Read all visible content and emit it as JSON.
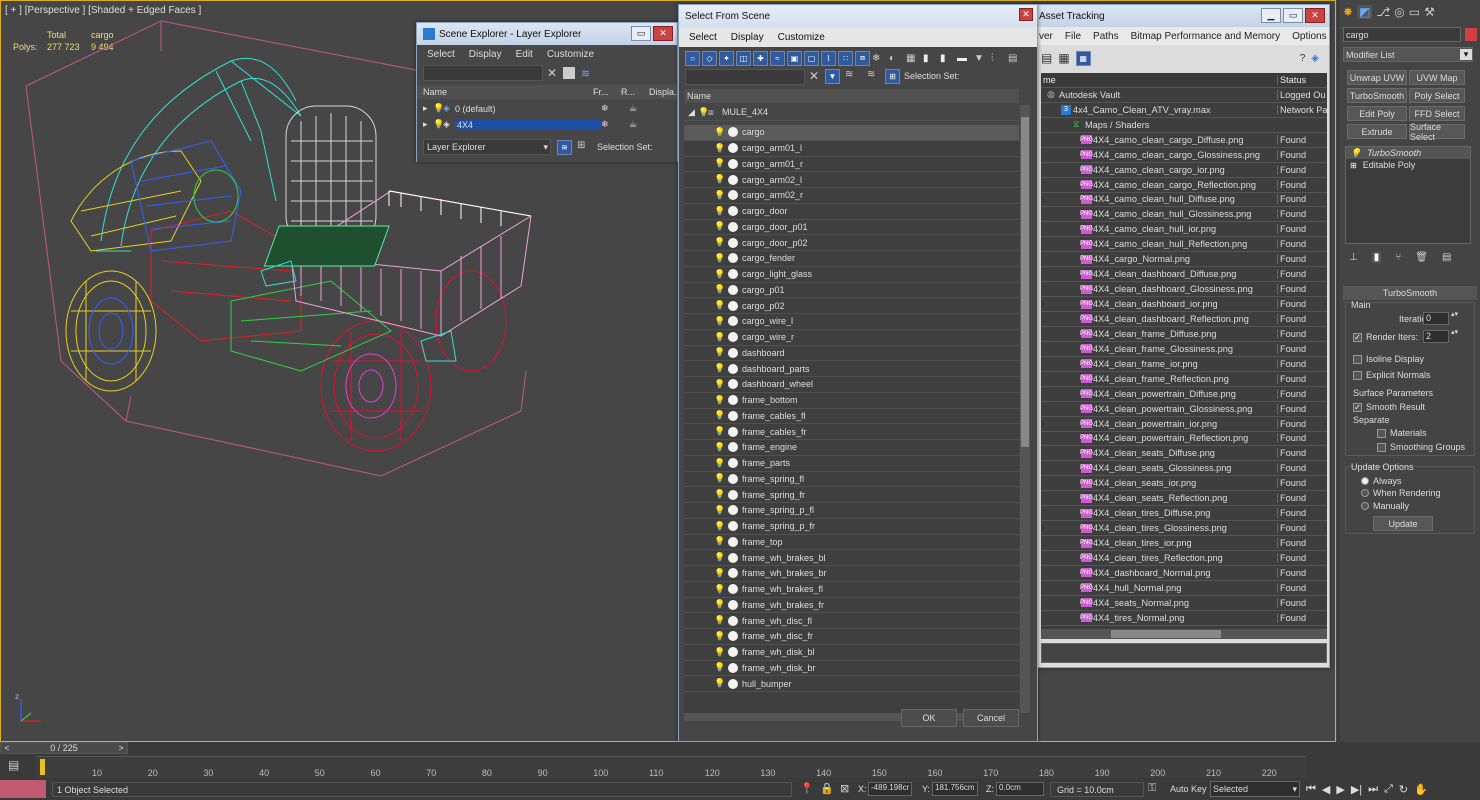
{
  "viewport": {
    "label": "[ + ] [Perspective ] [Shaded + Edged Faces ]",
    "stats": {
      "h1": "Total",
      "h2": "cargo",
      "label": "Polys:",
      "total": "277 723",
      "cargo": "9 494"
    }
  },
  "scene_explorer": {
    "title": "Scene Explorer - Layer Explorer",
    "menu": [
      "Select",
      "Display",
      "Edit",
      "Customize"
    ],
    "columns": [
      "Name",
      "Fr...",
      "R...",
      "Displa..."
    ],
    "layers": [
      {
        "name": "0 (default)"
      },
      {
        "name": "4X4"
      }
    ],
    "footer_dropdown": "Layer Explorer",
    "footer_label": "Selection Set:"
  },
  "select_from_scene": {
    "title": "Select From Scene",
    "menu": [
      "Select",
      "Display",
      "Customize"
    ],
    "selection_set_label": "Selection Set:",
    "column_name": "Name",
    "root": "MULE_4X4",
    "items": [
      "cargo",
      "cargo_arm01_l",
      "cargo_arm01_r",
      "cargo_arm02_l",
      "cargo_arm02_r",
      "cargo_door",
      "cargo_door_p01",
      "cargo_door_p02",
      "cargo_fender",
      "cargo_light_glass",
      "cargo_p01",
      "cargo_p02",
      "cargo_wire_l",
      "cargo_wire_r",
      "dashboard",
      "dashboard_parts",
      "dashboard_wheel",
      "frame_bottom",
      "frame_cables_fl",
      "frame_cables_fr",
      "frame_engine",
      "frame_parts",
      "frame_spring_fl",
      "frame_spring_fr",
      "frame_spring_p_fl",
      "frame_spring_p_fr",
      "frame_top",
      "frame_wh_brakes_bl",
      "frame_wh_brakes_br",
      "frame_wh_brakes_fl",
      "frame_wh_brakes_fr",
      "frame_wh_disc_fl",
      "frame_wh_disc_fr",
      "frame_wh_disk_bl",
      "frame_wh_disk_br",
      "hull_bumper"
    ],
    "ok": "OK",
    "cancel": "Cancel"
  },
  "asset_tracking": {
    "title": "Asset Tracking",
    "menu": [
      "ver",
      "File",
      "Paths",
      "Bitmap Performance and Memory",
      "Options"
    ],
    "col_name": "me",
    "col_status": "Status",
    "vault": {
      "name": "Autodesk Vault",
      "status": "Logged Ou"
    },
    "max_file": {
      "name": "4x4_Camo_Clean_ATV_vray.max",
      "status": "Network Pa"
    },
    "maps_label": "Maps / Shaders",
    "files": [
      {
        "name": "4X4_camo_clean_cargo_Diffuse.png",
        "status": "Found"
      },
      {
        "name": "4X4_camo_clean_cargo_Glossiness.png",
        "status": "Found"
      },
      {
        "name": "4X4_camo_clean_cargo_ior.png",
        "status": "Found"
      },
      {
        "name": "4X4_camo_clean_cargo_Reflection.png",
        "status": "Found"
      },
      {
        "name": "4X4_camo_clean_hull_Diffuse.png",
        "status": "Found"
      },
      {
        "name": "4X4_camo_clean_hull_Glossiness.png",
        "status": "Found"
      },
      {
        "name": "4X4_camo_clean_hull_ior.png",
        "status": "Found"
      },
      {
        "name": "4X4_camo_clean_hull_Reflection.png",
        "status": "Found"
      },
      {
        "name": "4X4_cargo_Normal.png",
        "status": "Found"
      },
      {
        "name": "4X4_clean_dashboard_Diffuse.png",
        "status": "Found"
      },
      {
        "name": "4X4_clean_dashboard_Glossiness.png",
        "status": "Found"
      },
      {
        "name": "4X4_clean_dashboard_ior.png",
        "status": "Found"
      },
      {
        "name": "4X4_clean_dashboard_Reflection.png",
        "status": "Found"
      },
      {
        "name": "4X4_clean_frame_Diffuse.png",
        "status": "Found"
      },
      {
        "name": "4X4_clean_frame_Glossiness.png",
        "status": "Found"
      },
      {
        "name": "4X4_clean_frame_ior.png",
        "status": "Found"
      },
      {
        "name": "4X4_clean_frame_Reflection.png",
        "status": "Found"
      },
      {
        "name": "4X4_clean_powertrain_Diffuse.png",
        "status": "Found"
      },
      {
        "name": "4X4_clean_powertrain_Glossiness.png",
        "status": "Found"
      },
      {
        "name": "4X4_clean_powertrain_ior.png",
        "status": "Found"
      },
      {
        "name": "4X4_clean_powertrain_Reflection.png",
        "status": "Found"
      },
      {
        "name": "4X4_clean_seats_Diffuse.png",
        "status": "Found"
      },
      {
        "name": "4X4_clean_seats_Glossiness.png",
        "status": "Found"
      },
      {
        "name": "4X4_clean_seats_ior.png",
        "status": "Found"
      },
      {
        "name": "4X4_clean_seats_Reflection.png",
        "status": "Found"
      },
      {
        "name": "4X4_clean_tires_Diffuse.png",
        "status": "Found"
      },
      {
        "name": "4X4_clean_tires_Glossiness.png",
        "status": "Found"
      },
      {
        "name": "4X4_clean_tires_ior.png",
        "status": "Found"
      },
      {
        "name": "4X4_clean_tires_Reflection.png",
        "status": "Found"
      },
      {
        "name": "4X4_dashboard_Normal.png",
        "status": "Found"
      },
      {
        "name": "4X4_hull_Normal.png",
        "status": "Found"
      },
      {
        "name": "4X4_seats_Normal.png",
        "status": "Found"
      },
      {
        "name": "4X4_tires_Normal.png",
        "status": "Found"
      }
    ]
  },
  "command_panel": {
    "object_name": "cargo",
    "modifier_list": "Modifier List",
    "buttons": [
      "Unwrap UVW",
      "UVW Map",
      "TurboSmooth",
      "Poly Select",
      "Edit Poly",
      "FFD Select",
      "Extrude",
      "Surface Select"
    ],
    "stack": [
      "TurboSmooth",
      "Editable Poly"
    ],
    "rollout_title": "TurboSmooth",
    "main_label": "Main",
    "iterations_label": "Iterations:",
    "iterations_value": "0",
    "render_iters_label": "Render Iters:",
    "render_iters_value": "2",
    "isoline_label": "Isoline Display",
    "explicit_label": "Explicit Normals",
    "surface_params": "Surface Parameters",
    "smooth_result": "Smooth Result",
    "separate": "Separate",
    "materials": "Materials",
    "smoothing_groups": "Smoothing Groups",
    "update_options": "Update Options",
    "always": "Always",
    "when_rendering": "When Rendering",
    "manually": "Manually",
    "update_btn": "Update"
  },
  "timeline": {
    "frame": "0 / 225",
    "ticks": [
      "10",
      "20",
      "30",
      "40",
      "50",
      "60",
      "70",
      "80",
      "90",
      "100",
      "110",
      "120",
      "130",
      "140",
      "150",
      "160",
      "170",
      "180",
      "190",
      "200",
      "210",
      "220"
    ],
    "status": "1 Object Selected",
    "x_label": "X:",
    "x_value": "-489.198cr",
    "y_label": "Y:",
    "y_value": "181.756cm",
    "z_label": "Z:",
    "z_value": "0.0cm",
    "grid": "Grid = 10.0cm",
    "auto_key": "Auto Key",
    "selected": "Selected"
  },
  "colors": {
    "accent": "#2f5a9e",
    "selection": "#1e4fa8",
    "viewport_border": "#d8b020"
  }
}
